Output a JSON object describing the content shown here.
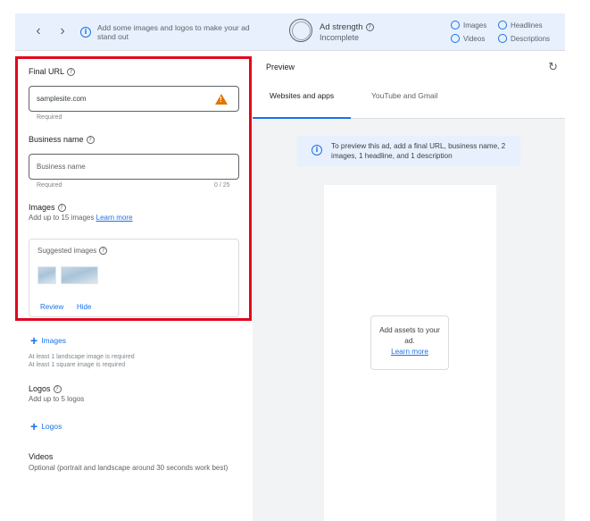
{
  "topbar": {
    "back_icon": "chevron-left-icon",
    "forward_icon": "chevron-right-icon",
    "tip": "Add some images and logos to make your ad stand out",
    "strength_title": "Ad strength",
    "strength_status": "Incomplete",
    "checklist": [
      "Images",
      "Headlines",
      "Videos",
      "Descriptions"
    ]
  },
  "form": {
    "final_url": {
      "label": "Final URL",
      "value": "samplesite.com",
      "hint": "Required"
    },
    "business_name": {
      "label": "Business name",
      "placeholder": "Business name",
      "hint": "Required",
      "counter": "0 / 25"
    },
    "images": {
      "label": "Images",
      "sub": "Add up to 15 images",
      "learn_more": "Learn more",
      "suggested_title": "Suggested images",
      "review": "Review",
      "hide": "Hide",
      "add_label": "Images",
      "req_1": "At least 1 landscape image is required",
      "req_2": "At least 1 square image is required"
    },
    "logos": {
      "label": "Logos",
      "sub": "Add up to 5 logos",
      "add_label": "Logos"
    },
    "videos": {
      "label": "Videos",
      "sub": "Optional (portrait and landscape around 30 seconds work best)"
    }
  },
  "preview": {
    "title": "Preview",
    "tabs": [
      "Websites and apps",
      "YouTube and Gmail"
    ],
    "notice": "To preview this ad, add a final URL, business name, 2 images, 1 headline, and 1 description",
    "assets_text": "Add assets to your ad.",
    "assets_link": "Learn more"
  },
  "colors": {
    "accent": "#1a73e8",
    "warning": "#e37400",
    "highlight": "#e3051f"
  }
}
